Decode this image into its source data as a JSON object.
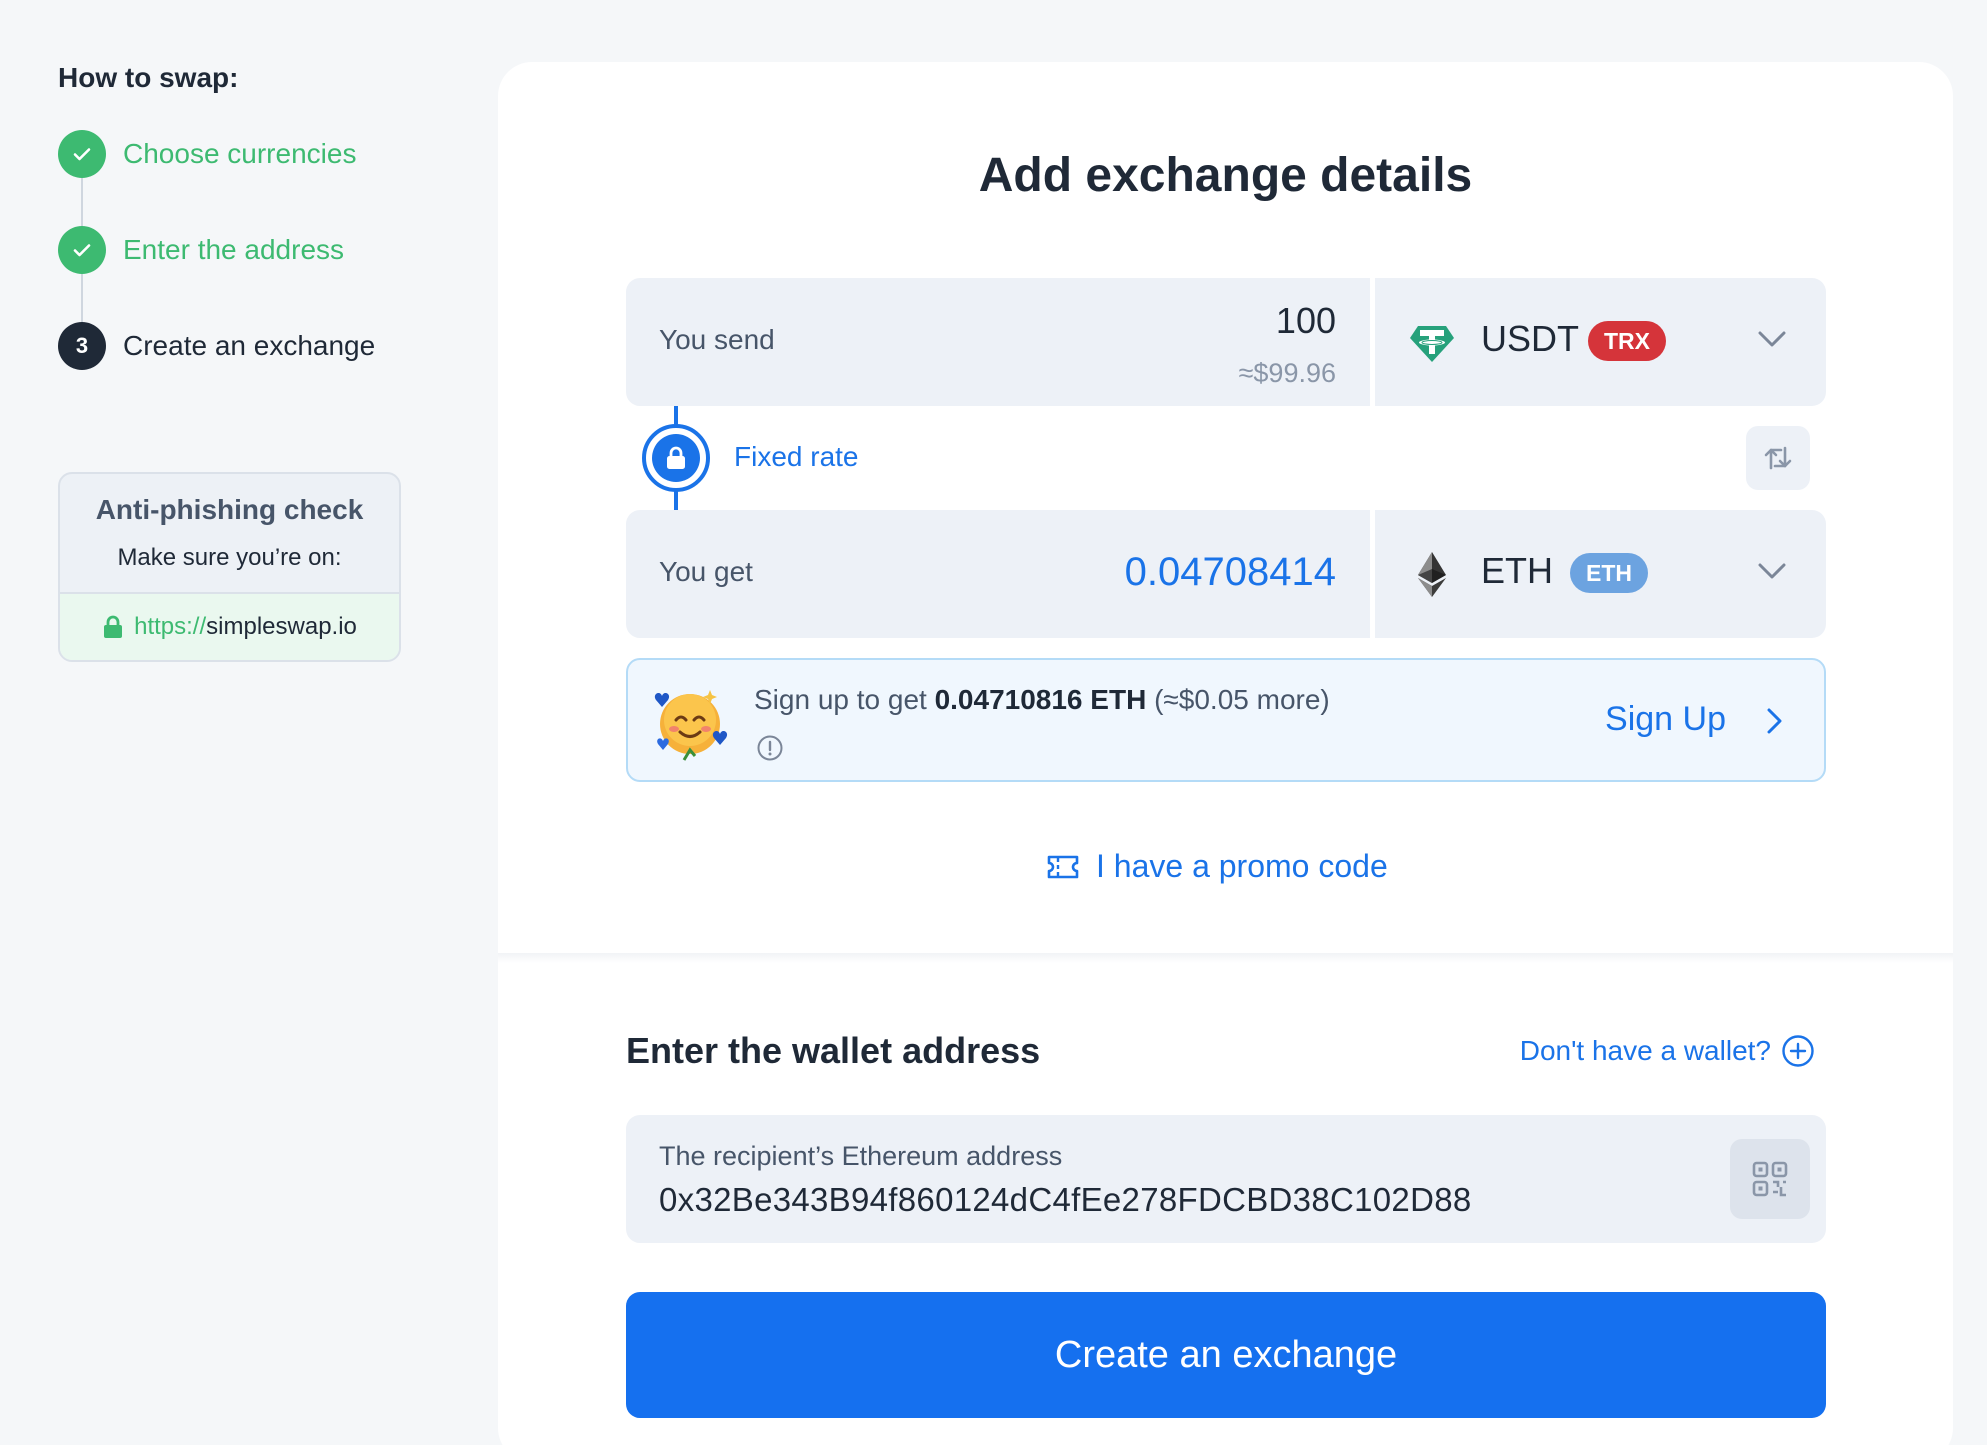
{
  "sidebar": {
    "title": "How to swap:",
    "steps": [
      {
        "label": "Choose currencies",
        "state": "done"
      },
      {
        "label": "Enter the address",
        "state": "done"
      },
      {
        "label": "Create an exchange",
        "state": "active",
        "number": "3"
      }
    ],
    "anti_phishing": {
      "title": "Anti-phishing check",
      "subtitle": "Make sure you’re on:",
      "url_protocol": "https://",
      "url_host": "simpleswap.io"
    }
  },
  "main": {
    "title": "Add exchange details",
    "send": {
      "label": "You send",
      "amount": "100",
      "usd_estimate": "≈$99.96",
      "currency": "USDT",
      "network": "TRX",
      "icon": "tether-icon"
    },
    "rate": {
      "label": "Fixed rate"
    },
    "get": {
      "label": "You get",
      "amount": "0.04708414",
      "currency": "ETH",
      "network": "ETH",
      "icon": "ethereum-icon"
    },
    "signup_banner": {
      "text_prefix": "Sign up to get ",
      "bonus_amount": "0.04710816 ETH",
      "text_suffix": " (≈$0.05 more)",
      "link": "Sign Up"
    },
    "promo": {
      "label": "I have a promo code"
    },
    "wallet": {
      "title": "Enter the wallet address",
      "no_wallet_link": "Don't have a wallet?",
      "field_label": "The recipient’s Ethereum address",
      "address": "0x32Be343B94f860124dC4fEe278FDCBD38C102D88"
    },
    "submit_label": "Create an exchange"
  },
  "colors": {
    "accent": "#1a73e8",
    "success": "#3dba71",
    "trx_badge": "#d5343a",
    "eth_badge": "#6ca3e0",
    "button": "#1570ef"
  }
}
